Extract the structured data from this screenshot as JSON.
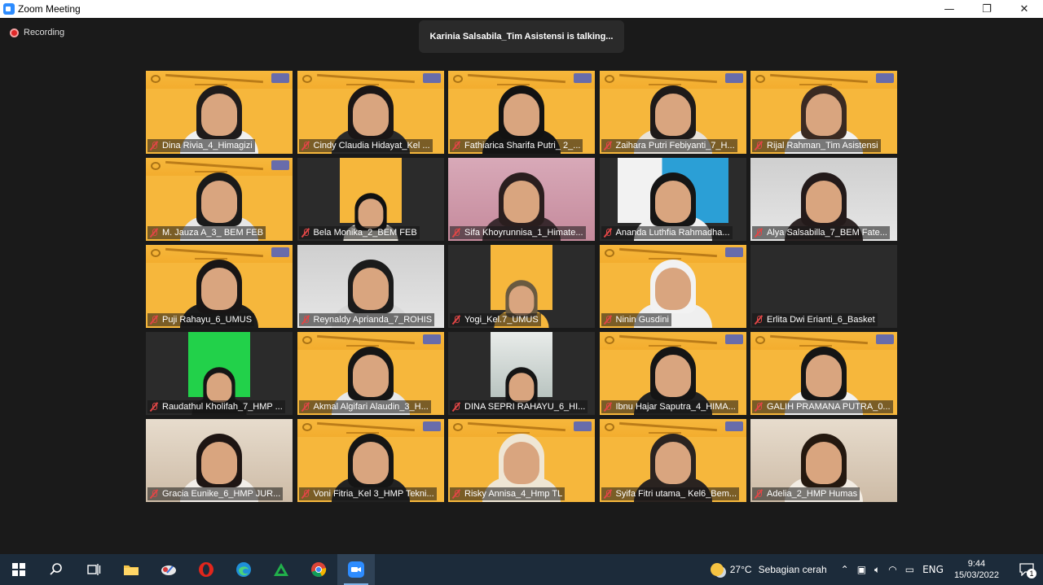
{
  "window": {
    "title": "Zoom Meeting",
    "controls": {
      "minimize": "—",
      "restore": "❐",
      "close": "✕"
    }
  },
  "meeting": {
    "recording_label": "Recording",
    "talking_text": "Karinia Salsabila_Tim Asistensi is talking...",
    "participants": [
      {
        "name": "Dina Rivia_4_Himagizi",
        "bg": "banner",
        "hair": "#1f1b1b",
        "shirt": "#f0f0f0",
        "muted": true
      },
      {
        "name": "Cindy Claudia Hidayat_Kel ...",
        "bg": "banner",
        "hair": "#1a1616",
        "shirt": "#2a2a2a",
        "muted": true
      },
      {
        "name": "Fathiarica Sharifa Putri_ 2_...",
        "bg": "banner",
        "hair": "#121212",
        "shirt": "#141414",
        "muted": true
      },
      {
        "name": "Zaihara Putri Febiyanti_7_H...",
        "bg": "banner",
        "hair": "#1e1a19",
        "shirt": "#e8e2da",
        "muted": true
      },
      {
        "name": "Rijal Rahman_Tim Asistensi",
        "bg": "banner",
        "hair": "#3a2a22",
        "shirt": "#f2f2f2",
        "muted": true
      },
      {
        "name": "M. Jauza A_3_ BEM FEB",
        "bg": "banner",
        "hair": "#1a1a1a",
        "shirt": "#e7e7e7",
        "muted": true
      },
      {
        "name": "Bela Monika_2_BEM FEB",
        "bg": "narrow",
        "hair": "#111",
        "shirt": "#e8e4dc",
        "muted": true
      },
      {
        "name": "Sifa Khoyrunnisa_1_Himate...",
        "bg": "pink",
        "hair": "#2a1e1e",
        "shirt": "#3b2a2f",
        "muted": true
      },
      {
        "name": "Ananda Luthfia Rahmadha...",
        "bg": "blue",
        "hair": "#151515",
        "shirt": "#f1f1f1",
        "muted": true
      },
      {
        "name": "Alya Salsabilla_7_BEM Fate...",
        "bg": "gray",
        "hair": "#231a1a",
        "shirt": "#2e2525",
        "muted": true
      },
      {
        "name": "Puji Rahayu_6_UMUS",
        "bg": "banner",
        "hair": "#181515",
        "shirt": "#1c1c1c",
        "muted": true
      },
      {
        "name": "Reynaldy Aprianda_7_ROHIS",
        "bg": "gray",
        "hair": "#1b1b1b",
        "shirt": "#d8d8d8",
        "muted": true
      },
      {
        "name": "Yogi_Kel.7_UMUS",
        "bg": "narrow",
        "hair": "#6a5a40",
        "shirt": "#f6b73c",
        "muted": true
      },
      {
        "name": "Ninin Gusdini",
        "bg": "banner",
        "hair": "#f2f2f2",
        "shirt": "#efefef",
        "muted": true
      },
      {
        "name": "Erlita Dwi Erianti_6_Basket",
        "bg": "dark",
        "hair": "none",
        "shirt": "none",
        "muted": true
      },
      {
        "name": "Raudathul Kholifah_7_HMP ...",
        "bg": "green",
        "hair": "#151515",
        "shirt": "#1a1a1a",
        "muted": true
      },
      {
        "name": "Akmal Algifari Alaudin_3_H...",
        "bg": "banner",
        "hair": "#151515",
        "shirt": "#e8e8e8",
        "muted": true
      },
      {
        "name": "DINA SEPRI RAHAYU_6_HI...",
        "bg": "room",
        "hair": "#151515",
        "shirt": "#2a2a2a",
        "muted": true
      },
      {
        "name": "Ibnu Hajar Saputra_4_HIMA...",
        "bg": "banner",
        "hair": "#151515",
        "shirt": "#222",
        "muted": true
      },
      {
        "name": "GALIH PRAMANA PUTRA_0...",
        "bg": "banner",
        "hair": "#151515",
        "shirt": "#f1f1f1",
        "muted": true
      },
      {
        "name": "Gracia Eunike_6_HMP JUR...",
        "bg": "warm",
        "hair": "#1e1513",
        "shirt": "#f2eee9",
        "muted": true
      },
      {
        "name": "Voni Fitria_Kel 3_HMP Tekni...",
        "bg": "banner",
        "hair": "#151515",
        "shirt": "#222",
        "muted": true
      },
      {
        "name": "Risky Annisa_4_Hmp TL",
        "bg": "banner",
        "hair": "#efe6d4",
        "shirt": "#efe6d4",
        "muted": true
      },
      {
        "name": "Syifa Fitri utama_ Kel6_Bem...",
        "bg": "banner",
        "hair": "#2a2320",
        "shirt": "#2a2320",
        "muted": true
      },
      {
        "name": "Adelia_2_HMP Humas",
        "bg": "warm",
        "hair": "#24180f",
        "shirt": "#f3ede4",
        "muted": true
      }
    ]
  },
  "taskbar": {
    "items": [
      {
        "id": "start",
        "icon": "windows-logo-icon"
      },
      {
        "id": "search",
        "icon": "search-icon"
      },
      {
        "id": "task-view",
        "icon": "task-view-icon"
      },
      {
        "id": "file-explorer",
        "icon": "folder-icon"
      },
      {
        "id": "app-cloud",
        "icon": "cloud-app-icon"
      },
      {
        "id": "opera",
        "icon": "opera-icon"
      },
      {
        "id": "edge",
        "icon": "edge-icon"
      },
      {
        "id": "app-green",
        "icon": "green-triangle-app-icon"
      },
      {
        "id": "chrome",
        "icon": "chrome-icon"
      },
      {
        "id": "zoom",
        "icon": "zoom-icon",
        "active": true
      }
    ],
    "weather": {
      "temp": "27°C",
      "condition": "Sebagian cerah"
    },
    "language": "ENG",
    "time": "9:44",
    "date": "15/03/2022",
    "notification_count": "1"
  }
}
